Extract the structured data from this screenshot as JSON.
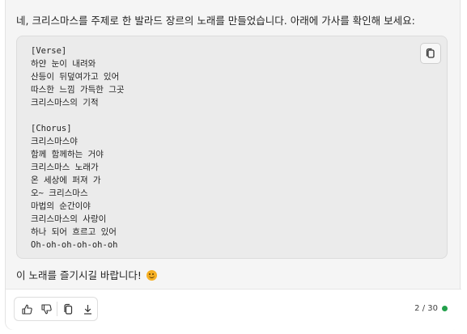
{
  "message": {
    "intro": "네, 크리스마스를 주제로 한 발라드 장르의 노래를 만들었습니다. 아래에 가사를 확인해 보세요:",
    "lyrics": [
      "[Verse]",
      "하얀 눈이 내려와",
      "산등이 뒤덮여가고 있어",
      "따스한 느낌 가득한 그곳",
      "크리스마스의 기적",
      "",
      "[Chorus]",
      "크리스마스야",
      "함께 함께하는 거야",
      "크리스마스 노래가",
      "온 세상에 퍼져 가",
      "오~ 크리스마스",
      "마법의 순간이야",
      "크리스마스의 사랑이",
      "하나 되어 흐르고 있어",
      "Oh-oh-oh-oh-oh-oh"
    ],
    "outro": "이 노래를 즐기시길 바랍니다!",
    "outro_emoji": "smiling-face-emoji"
  },
  "code_block": {
    "copy_icon": "copy-icon"
  },
  "toolbar": {
    "actions": [
      {
        "icon": "thumbs-up-icon"
      },
      {
        "icon": "thumbs-down-icon"
      },
      {
        "icon": "copy-icon"
      },
      {
        "icon": "download-icon"
      }
    ],
    "response_counter": "2 / 30",
    "status_color": "#22a04b"
  }
}
